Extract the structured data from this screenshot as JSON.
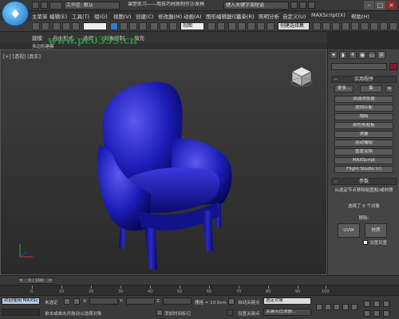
{
  "window": {
    "workspace": "工作区: 默认",
    "doc_title": "课堂练习——用技巧材质制作沙发椅",
    "search_placeholder": "键入关键字或短语"
  },
  "menu": [
    "主菜单",
    "编辑(E)",
    "工具(T)",
    "组(G)",
    "视图(V)",
    "创建(C)",
    "修改器(M)",
    "动画(A)",
    "图形编辑器(D)",
    "渲染(R)",
    "照明分析",
    "自定义(U)",
    "MAXScript(X)",
    "帮助(H)"
  ],
  "toolbar": {
    "view_select": "视图",
    "selection_set": "创建选择集"
  },
  "ribbon": {
    "tabs": [
      "建模",
      "自由形式",
      "选择",
      "对象绘制",
      "填充"
    ],
    "subtabs": [
      "多边形建模"
    ]
  },
  "watermark": "www.pc0359.cn",
  "viewport": {
    "label": "[+] [透视] [真实]"
  },
  "command_panel": {
    "utilities_title": "实用程序",
    "more_button": "更多...",
    "sets_button": "集",
    "utilities": [
      "资源浏览器",
      "透视匹配",
      "塌陷",
      "颜色剪贴板",
      "测量",
      "运动捕捉",
      "重置变换",
      "MAXScript",
      "Flight Studio (c)"
    ],
    "params_title": "参数",
    "params_desc": "从选定节点移除贴图和/或材质",
    "selected_count": "选择了 0 个对象",
    "remove_label": "移除:",
    "uvw_button": "UVW",
    "material_button": "材质",
    "set_default_label": "设置到置"
  },
  "timeline": {
    "frame_display": "0 / 100",
    "ticks": [
      "0",
      "10",
      "20",
      "30",
      "40",
      "50",
      "60",
      "70",
      "80",
      "90",
      "100"
    ]
  },
  "status": {
    "welcome": "欢迎使用 MAXSc",
    "not_selected": "未选定",
    "x_label": "X:",
    "y_label": "Y:",
    "z_label": "Z:",
    "grid": "栅格 = 10.0cm",
    "auto_key": "自动关键点",
    "selected_object": "选定对象",
    "prompt": "单击或单击并拖动以选择对象",
    "add_time_tag": "添加时间标记",
    "set_key": "设置关键点",
    "key_filter": "关键点过滤器..."
  },
  "colors": {
    "chair": "#1a1a9c",
    "swatch": "#8a1530",
    "active_tool": "#2f7fc7"
  }
}
